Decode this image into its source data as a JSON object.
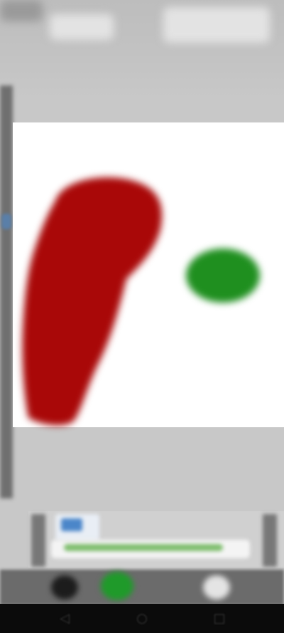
{
  "app": {
    "accent": "#1f9a2a",
    "canvas_bg": "#ffffff"
  },
  "canvas": {
    "strokes": [
      {
        "name": "red-freehand-stroke",
        "color": "#a90808"
      },
      {
        "name": "green-dot-stroke",
        "color": "#1f8f1f"
      }
    ]
  },
  "panel": {
    "selected_color": "#4b86c9",
    "size_slider_fraction": 0.86
  },
  "toolbar": {
    "tools": [
      {
        "name": "pen-icon",
        "color": "#1c1c1c"
      },
      {
        "name": "color-picker-icon",
        "color": "#1f9a2a"
      },
      {
        "name": "eraser-icon",
        "color": "#e4e4e4"
      }
    ]
  },
  "nav": {
    "back_glyph": "◁",
    "home_glyph": "○",
    "recent_glyph": "□"
  }
}
